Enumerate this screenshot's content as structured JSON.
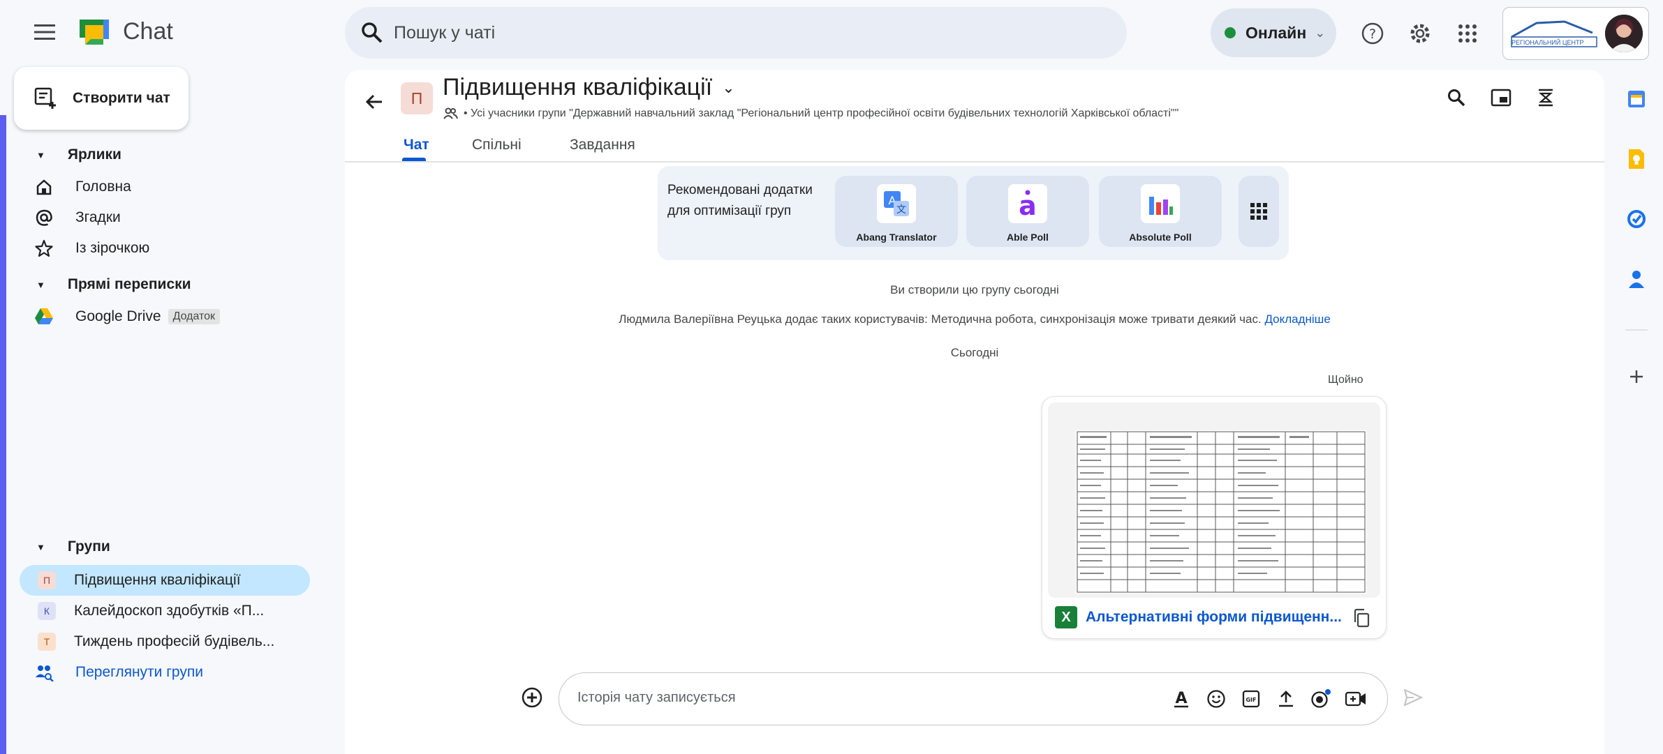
{
  "app": {
    "title": "Chat"
  },
  "search": {
    "placeholder": "Пошук у чаті"
  },
  "status": {
    "label": "Онлайн",
    "color": "#1e8e3e"
  },
  "account": {
    "org_logo_text": "РЕГІОНАЛЬНИЙ ЦЕНТР"
  },
  "sidebar": {
    "new_chat": "Створити чат",
    "shortcuts_header": "Ярлики",
    "shortcuts": [
      {
        "label": "Головна",
        "icon": "home-icon"
      },
      {
        "label": "Згадки",
        "icon": "at-icon"
      },
      {
        "label": "Із зірочкою",
        "icon": "star-icon"
      }
    ],
    "dm_header": "Прямі переписки",
    "dms": [
      {
        "label": "Google Drive",
        "badge": "Додаток",
        "icon": "google-drive-icon"
      }
    ],
    "groups_header": "Групи",
    "groups": [
      {
        "initial": "П",
        "label": "Підвищення кваліфікації",
        "active": true
      },
      {
        "initial": "К",
        "label": "Калейдоскоп здобутків «П..."
      },
      {
        "initial": "Т",
        "label": "Тиждень професій будівель..."
      }
    ],
    "browse_groups": "Переглянути групи"
  },
  "room": {
    "initial": "П",
    "title": "Підвищення кваліфікації",
    "subtitle": "• Усі учасники групи \"Державний навчальний заклад \"Регіональний центр професійної освіти будівельних технологій Харківської області\"\"",
    "tabs": [
      "Чат",
      "Спільні",
      "Завдання"
    ]
  },
  "addons": {
    "intro": "Рекомендовані додатки для оптимізації груп",
    "items": [
      {
        "name": "Abang Translator",
        "icon": "translate-icon"
      },
      {
        "name": "Able Poll",
        "icon": "able-poll-icon"
      },
      {
        "name": "Absolute Poll",
        "icon": "bar-chart-icon"
      }
    ]
  },
  "messages": {
    "created": "Ви створили цю групу сьогодні",
    "added": "Людмила Валеріївна Реуцька додає таких користувачів: Методична робота, синхронізація може тривати деякий час.",
    "added_link": "Докладніше",
    "today": "Сьогодні",
    "time": "Щойно"
  },
  "attachment": {
    "name": "Альтернативні форми підвищенн...",
    "type_icon": "excel-icon",
    "type_letter": "X"
  },
  "composer": {
    "placeholder": "Історія чату записується"
  },
  "rail": {
    "accent": "#1a73e8"
  }
}
